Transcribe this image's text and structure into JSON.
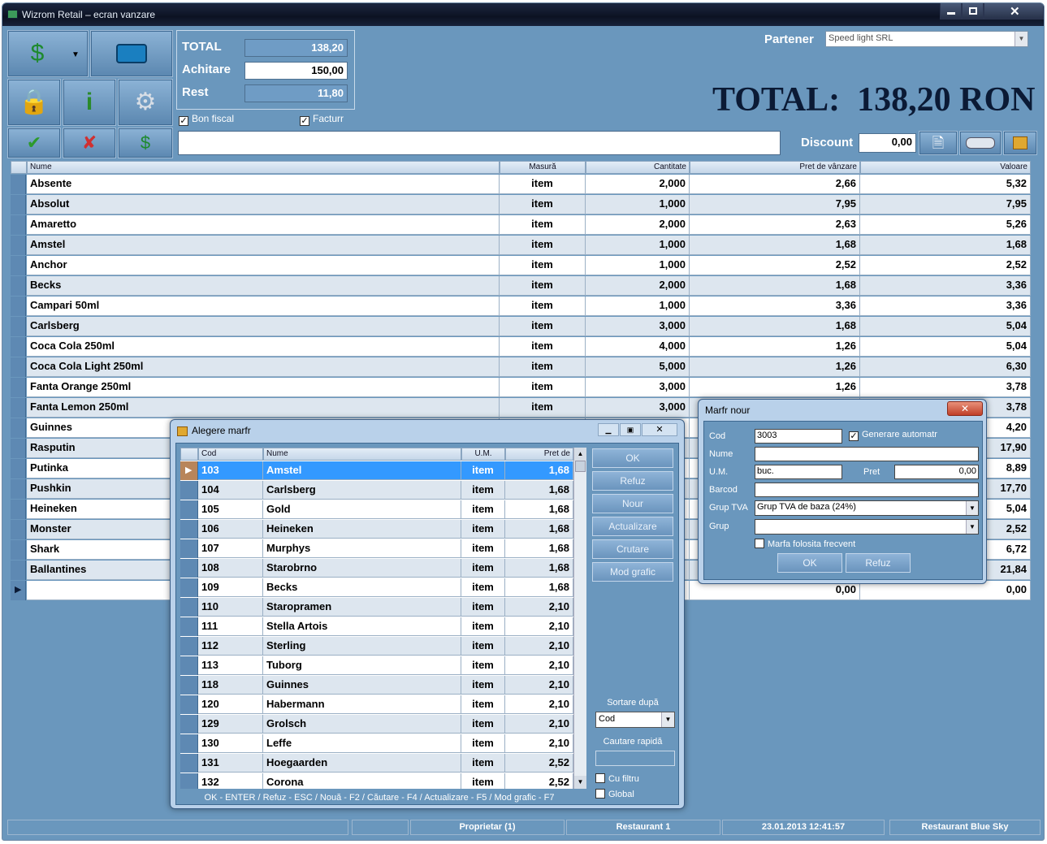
{
  "window": {
    "title": "Wizrom Retail – ecran vanzare"
  },
  "summary": {
    "total_label": "TOTAL",
    "total_value": "138,20",
    "achitare_label": "Achitare",
    "achitare_value": "150,00",
    "rest_label": "Rest",
    "rest_value": "11,80",
    "bon_fiscal": "Bon fiscal",
    "factura": "Facturr"
  },
  "partner": {
    "label": "Partener",
    "value": "Speed light SRL"
  },
  "big_total": "TOTAL:  138,20 RON",
  "discount": {
    "label": "Discount",
    "value": "0,00"
  },
  "grid": {
    "headers": [
      "Nume",
      "Masură",
      "Cantitate",
      "Pret de vânzare",
      "Valoare"
    ],
    "rows": [
      [
        "Absente",
        "item",
        "2,000",
        "2,66",
        "5,32"
      ],
      [
        "Absolut",
        "item",
        "1,000",
        "7,95",
        "7,95"
      ],
      [
        "Amaretto",
        "item",
        "2,000",
        "2,63",
        "5,26"
      ],
      [
        "Amstel",
        "item",
        "1,000",
        "1,68",
        "1,68"
      ],
      [
        "Anchor",
        "item",
        "1,000",
        "2,52",
        "2,52"
      ],
      [
        "Becks",
        "item",
        "2,000",
        "1,68",
        "3,36"
      ],
      [
        "Campari 50ml",
        "item",
        "1,000",
        "3,36",
        "3,36"
      ],
      [
        "Carlsberg",
        "item",
        "3,000",
        "1,68",
        "5,04"
      ],
      [
        "Coca Cola 250ml",
        "item",
        "4,000",
        "1,26",
        "5,04"
      ],
      [
        "Coca Cola Light 250ml",
        "item",
        "5,000",
        "1,26",
        "6,30"
      ],
      [
        "Fanta Orange 250ml",
        "item",
        "3,000",
        "1,26",
        "3,78"
      ],
      [
        "Fanta Lemon 250ml",
        "item",
        "3,000",
        "",
        "3,78"
      ],
      [
        "Guinnes",
        "",
        "",
        "",
        "4,20"
      ],
      [
        "Rasputin",
        "",
        "",
        "",
        "17,90"
      ],
      [
        "Putinka",
        "",
        "",
        "",
        "8,89"
      ],
      [
        "Pushkin",
        "",
        "",
        "",
        "17,70"
      ],
      [
        "Heineken",
        "",
        "",
        "",
        "5,04"
      ],
      [
        "Monster",
        "",
        "",
        "",
        "2,52"
      ],
      [
        "Shark",
        "",
        "",
        "",
        "6,72"
      ],
      [
        "Ballantines",
        "",
        "",
        "",
        "21,84"
      ],
      [
        "",
        "",
        "",
        "0,00",
        "0,00"
      ]
    ]
  },
  "alegere": {
    "title": "Alegere marfr",
    "headers": [
      "Cod",
      "Nume",
      "U.M.",
      "Pret de"
    ],
    "rows": [
      [
        "103",
        "Amstel",
        "item",
        "1,68"
      ],
      [
        "104",
        "Carlsberg",
        "item",
        "1,68"
      ],
      [
        "105",
        "Gold",
        "item",
        "1,68"
      ],
      [
        "106",
        "Heineken",
        "item",
        "1,68"
      ],
      [
        "107",
        "Murphys",
        "item",
        "1,68"
      ],
      [
        "108",
        "Starobrno",
        "item",
        "1,68"
      ],
      [
        "109",
        "Becks",
        "item",
        "1,68"
      ],
      [
        "110",
        "Staropramen",
        "item",
        "2,10"
      ],
      [
        "111",
        "Stella Artois",
        "item",
        "2,10"
      ],
      [
        "112",
        "Sterling",
        "item",
        "2,10"
      ],
      [
        "113",
        "Tuborg",
        "item",
        "2,10"
      ],
      [
        "118",
        "Guinnes",
        "item",
        "2,10"
      ],
      [
        "120",
        "Habermann",
        "item",
        "2,10"
      ],
      [
        "129",
        "Grolsch",
        "item",
        "2,10"
      ],
      [
        "130",
        "Leffe",
        "item",
        "2,10"
      ],
      [
        "131",
        "Hoegaarden",
        "item",
        "2,52"
      ],
      [
        "132",
        "Corona",
        "item",
        "2,52"
      ]
    ],
    "buttons": [
      "OK",
      "Refuz",
      "Nour",
      "Actualizare",
      "Crutare",
      "Mod grafic"
    ],
    "sort_label": "Sortare după",
    "sort_value": "Cod",
    "quick_search_label": "Cautare rapidă",
    "cu_filtru": "Cu filtru",
    "global": "Global",
    "footer": "OK - ENTER / Refuz - ESC / Nouă - F2 / Căutare - F4 / Actualizare - F5 / Mod grafic - F7"
  },
  "marfa_noua": {
    "title": "Marfr nour",
    "cod_label": "Cod",
    "cod_value": "3003",
    "gen_auto": "Generare automatr",
    "nume_label": "Nume",
    "um_label": "U.M.",
    "um_value": "buc.",
    "pret_label": "Pret",
    "pret_value": "0,00",
    "barcod_label": "Barcod",
    "grup_tva_label": "Grup TVA",
    "grup_tva_value": "Grup TVA de baza (24%)",
    "grup_label": "Grup",
    "frecvent": "Marfa folosita frecvent",
    "ok": "OK",
    "refuz": "Refuz"
  },
  "status": [
    "",
    "",
    "Proprietar (1)",
    "Restaurant 1",
    "23.01.2013 12:41:57",
    "Restaurant Blue Sky"
  ]
}
